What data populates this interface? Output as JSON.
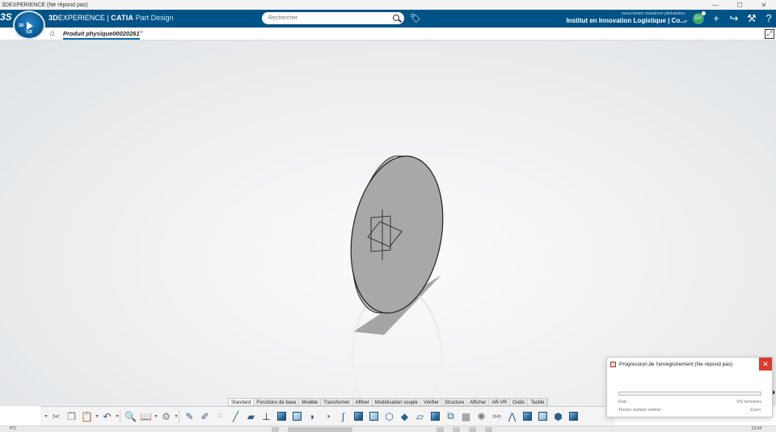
{
  "os_window": {
    "title": "3DEXPERIENCE (Ne répond pas)",
    "controls": [
      "—",
      "☐",
      "✕"
    ]
  },
  "header": {
    "ds_logo": "3S",
    "compass_3d": "3D",
    "compass_vr": "V,R",
    "brand_prefix": "3D",
    "brand_experience": "EXPERIENCE",
    "brand_sep": " | ",
    "brand_catia": "CATIA",
    "app_name": " Part Design",
    "search_placeholder": "Rechercher",
    "user_email": "essa-hanem mawatove pitekatabou",
    "user_org": "Institut en Innovation Logistique | Co...",
    "avatar_initials": "EP",
    "icons": [
      "tag-icon",
      "search-icon",
      "plus-icon",
      "share-icon",
      "tools-icon",
      "help-icon"
    ]
  },
  "tabs": {
    "home_icon": "⌂",
    "active_label": "Produit physique00020261",
    "add_label": "+"
  },
  "section_tabs": [
    "Standard",
    "Fonctions de base",
    "Modèle",
    "Transformer",
    "Affiner",
    "Modélisation souple",
    "Vérifier",
    "Structure",
    "Afficher",
    "AR-VR",
    "Outils",
    "Tactile"
  ],
  "active_section": "Standard",
  "dialog": {
    "title": "Progression de l'enregistrement (Ne répond pas)",
    "close": "✕",
    "state_label": "Etat :",
    "state_value": "0% terminés",
    "time_label": "Temps restant estimé :",
    "time_value": "11sec",
    "progress_fraction": 0.0
  },
  "taskbar": {
    "temperature": "8°C",
    "clock": "13:34"
  },
  "colors": {
    "header_bg": "#005386",
    "accent": "#0a6fb4",
    "close_red": "#d83b30",
    "part_grey": "#a8a8a8"
  }
}
